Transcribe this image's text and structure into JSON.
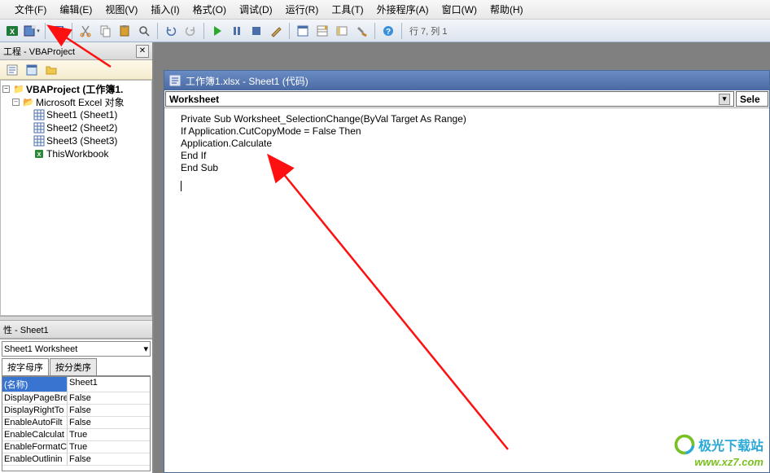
{
  "menu": {
    "file": "文件(F)",
    "edit": "编辑(E)",
    "view": "视图(V)",
    "insert": "插入(I)",
    "format": "格式(O)",
    "debug": "调试(D)",
    "run": "运行(R)",
    "tools": "工具(T)",
    "addins": "外接程序(A)",
    "window": "窗口(W)",
    "help": "帮助(H)"
  },
  "toolbar": {
    "position": "行 7, 列 1"
  },
  "project_panel": {
    "title": "工程 - VBAProject"
  },
  "tree": {
    "root": "VBAProject (工作簿1.",
    "folder": "Microsoft Excel 对象",
    "sheet1": "Sheet1 (Sheet1)",
    "sheet2": "Sheet2 (Sheet2)",
    "sheet3": "Sheet3 (Sheet3)",
    "thiswb": "ThisWorkbook"
  },
  "prop_panel": {
    "title": "性 - Sheet1",
    "combo": "Sheet1 Worksheet",
    "tab_alpha": "按字母序",
    "tab_cat": "按分类序"
  },
  "props": [
    {
      "name": "(名称)",
      "val": "Sheet1",
      "hl": true
    },
    {
      "name": "DisplayPageBre",
      "val": "False"
    },
    {
      "name": "DisplayRightTo",
      "val": "False"
    },
    {
      "name": "EnableAutoFilt",
      "val": "False"
    },
    {
      "name": "EnableCalculat",
      "val": "True"
    },
    {
      "name": "EnableFormatCo",
      "val": "True"
    },
    {
      "name": "EnableOutlinin",
      "val": "False"
    }
  ],
  "code_window": {
    "title": "工作簿1.xlsx - Sheet1 (代码)",
    "object_combo": "Worksheet",
    "proc_combo": "Sele"
  },
  "code": [
    "Private Sub Worksheet_SelectionChange(ByVal Target As Range)",
    "If Application.CutCopyMode = False Then",
    "Application.Calculate",
    "End If",
    "End Sub"
  ],
  "watermark": {
    "name": "极光下载站",
    "url": "www.xz7.com"
  }
}
